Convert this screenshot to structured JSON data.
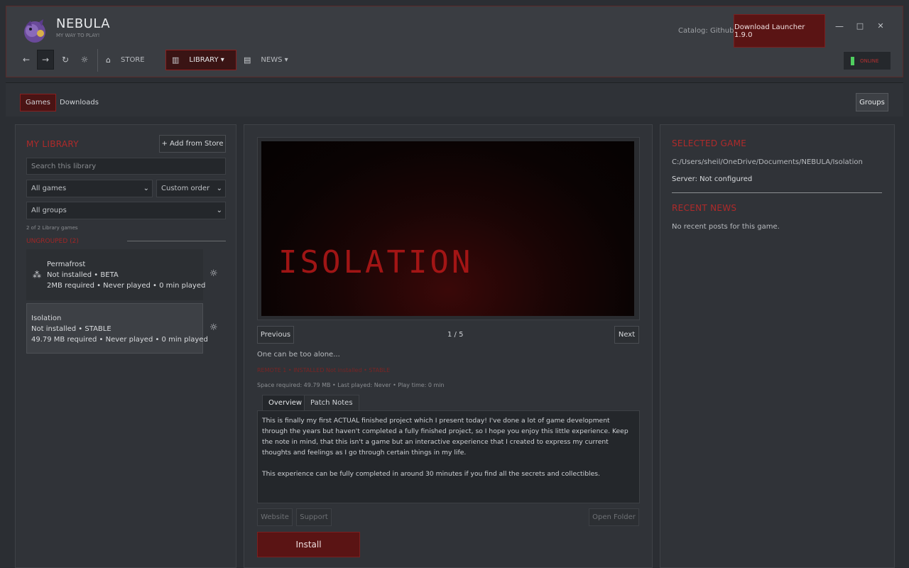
{
  "app": {
    "name": "NEBULA",
    "tagline": "MY WAY TO PLAY!",
    "catalog": "Catalog: Github",
    "download_launcher": "Download Launcher 1.9.0",
    "status": "ONLINE"
  },
  "window_controls": {
    "minimize": "—",
    "maximize": "□",
    "close": "✕"
  },
  "nav": {
    "back": "←",
    "forward": "→",
    "reload": "↻",
    "settings": "☼",
    "store": "STORE",
    "library": "LIBRARY ▾",
    "news": "NEWS ▾"
  },
  "subnav": {
    "tabs": [
      "Games",
      "Downloads"
    ],
    "active_tab": "Games",
    "groups": "Groups"
  },
  "library": {
    "title": "MY LIBRARY",
    "add_from_store": "+ Add from Store",
    "search_placeholder": "Search this library",
    "filter": "All games",
    "order": "Custom order",
    "group_filter": "All groups",
    "count": "2 of 2 Library games",
    "group_label": "UNGROUPED (2)",
    "games": [
      {
        "name": "Permafrost",
        "status": "Not installed • BETA",
        "details": "2MB required  •  Never played  •  0 min played",
        "selected": false
      },
      {
        "name": "Isolation",
        "status": "Not installed • STABLE",
        "details": "49.79 MB required  •  Never played  •  0 min played",
        "selected": true
      }
    ]
  },
  "detail": {
    "screenshot_title": "ISOLATION",
    "previous": "Previous",
    "next": "Next",
    "pager": "1 / 5",
    "tagline": "One can be too alone...",
    "meta_status": "REMOTE 1  •  INSTALLED Not installed  •  STABLE",
    "meta_stats": "Space required: 49.79 MB  •  Last played: Never  •  Play time: 0 min",
    "tabs": [
      "Overview",
      "Patch Notes"
    ],
    "active_tab": "Overview",
    "description_1": "This is finally my first ACTUAL finished project which I present today! I've done a lot of game development through the years but haven't completed a fully finished project, so I hope you enjoy this little experience.  Keep the note in mind, that this isn't a game but an interactive experience that I created to express my current thoughts and feelings as I go through certain things in my life.",
    "description_2": "This experience can be fully completed in around 30 minutes if you find all the secrets and collectibles.",
    "website": "Website",
    "support": "Support",
    "open_folder": "Open Folder",
    "install": "Install"
  },
  "selected_game": {
    "title": "SELECTED GAME",
    "path": "C:/Users/sheil/OneDrive/Documents/NEBULA/Isolation",
    "server": "Server: Not configured",
    "news_title": "RECENT NEWS",
    "news_empty": "No recent posts for this game."
  },
  "colors": {
    "accent": "#b02a2a",
    "accent_bg": "#5a1414",
    "panel": "#303338",
    "online": "#4fcf5f"
  }
}
